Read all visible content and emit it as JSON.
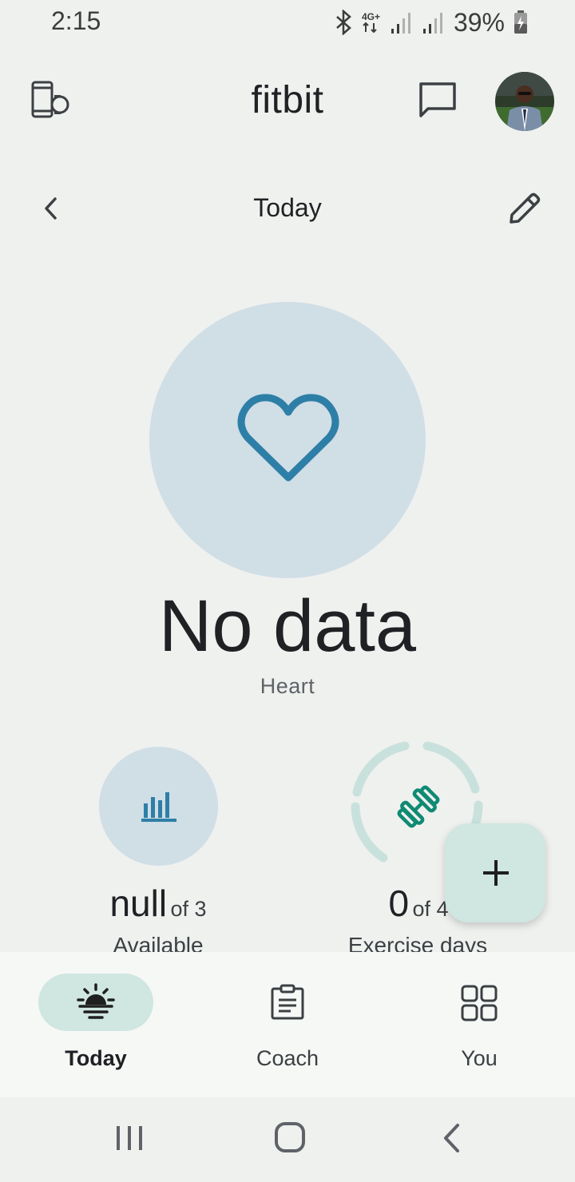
{
  "status_bar": {
    "time": "2:15",
    "network": "4G+",
    "battery": "39%"
  },
  "header": {
    "title": "fitbit",
    "icons": [
      "device-icon",
      "messages-icon",
      "avatar"
    ]
  },
  "date_nav": {
    "label": "Today",
    "icons": [
      "chevron-left-icon",
      "pencil-icon"
    ]
  },
  "heart": {
    "value": "No data",
    "caption": "Heart",
    "icon": "heart-icon"
  },
  "stats": [
    {
      "value": "null",
      "of": "of 3",
      "caption": "Available",
      "icon": "bar-chart-icon"
    },
    {
      "value": "0",
      "of": "of 4",
      "caption": "Exercise days",
      "icon": "dumbbell-icon"
    }
  ],
  "fab": {
    "icon": "plus-icon"
  },
  "bottom_nav": {
    "items": [
      {
        "label": "Today",
        "icon": "sunrise-icon",
        "active": true
      },
      {
        "label": "Coach",
        "icon": "clipboard-icon",
        "active": false
      },
      {
        "label": "You",
        "icon": "grid-icon",
        "active": false
      }
    ]
  },
  "colors": {
    "background": "#eff1ef",
    "circle_blue": "#d0dee6",
    "accent_blue": "#2e7fa7",
    "accent_teal": "#0f8a73",
    "fab": "#cfe6e1"
  }
}
